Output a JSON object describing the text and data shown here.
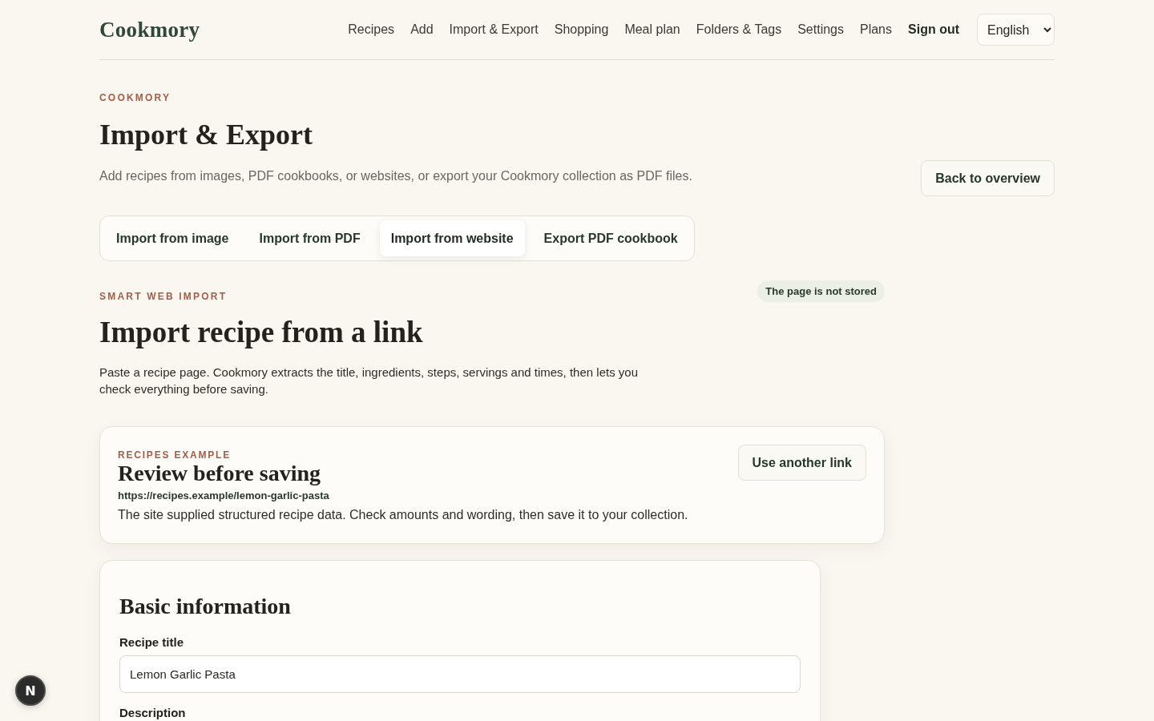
{
  "header": {
    "logo": "Cookmory",
    "nav": [
      {
        "label": "Recipes",
        "kind": "link"
      },
      {
        "label": "Add",
        "kind": "link"
      },
      {
        "label": "Import & Export",
        "kind": "link"
      },
      {
        "label": "Shopping",
        "kind": "link"
      },
      {
        "label": "Meal plan",
        "kind": "link"
      },
      {
        "label": "Folders & Tags",
        "kind": "link"
      },
      {
        "label": "Settings",
        "kind": "link"
      },
      {
        "label": "Plans",
        "kind": "link"
      },
      {
        "label": "Sign out",
        "kind": "action"
      }
    ],
    "language_select": {
      "value": "English"
    }
  },
  "page": {
    "eyebrow": "COOKMORY",
    "title": "Import & Export",
    "subtitle": "Add recipes from images, PDF cookbooks, or websites, or export your Cookmory collection as PDF files.",
    "back_button": "Back to overview"
  },
  "tabs": [
    {
      "label": "Import from image",
      "selected": false
    },
    {
      "label": "Import from PDF",
      "selected": false
    },
    {
      "label": "Import from website",
      "selected": true
    },
    {
      "label": "Export PDF cookbook",
      "selected": false
    }
  ],
  "import": {
    "eyebrow": "SMART WEB IMPORT",
    "badge": "The page is not stored",
    "title": "Import recipe from a link",
    "description": "Paste a recipe page. Cookmory extracts the title, ingredients, steps, servings and times, then lets you check everything before saving."
  },
  "review_card": {
    "eyebrow": "RECIPES EXAMPLE",
    "title": "Review before saving",
    "url": "https://recipes.example/lemon-garlic-pasta",
    "note": "The site supplied structured recipe data. Check amounts and wording, then save it to your collection.",
    "button": "Use another link"
  },
  "form": {
    "title": "Basic information",
    "fields": [
      {
        "label": "Recipe title",
        "value": "Lemon Garlic Pasta"
      },
      {
        "label": "Description"
      }
    ]
  },
  "dev_badge": {
    "label": "N"
  }
}
